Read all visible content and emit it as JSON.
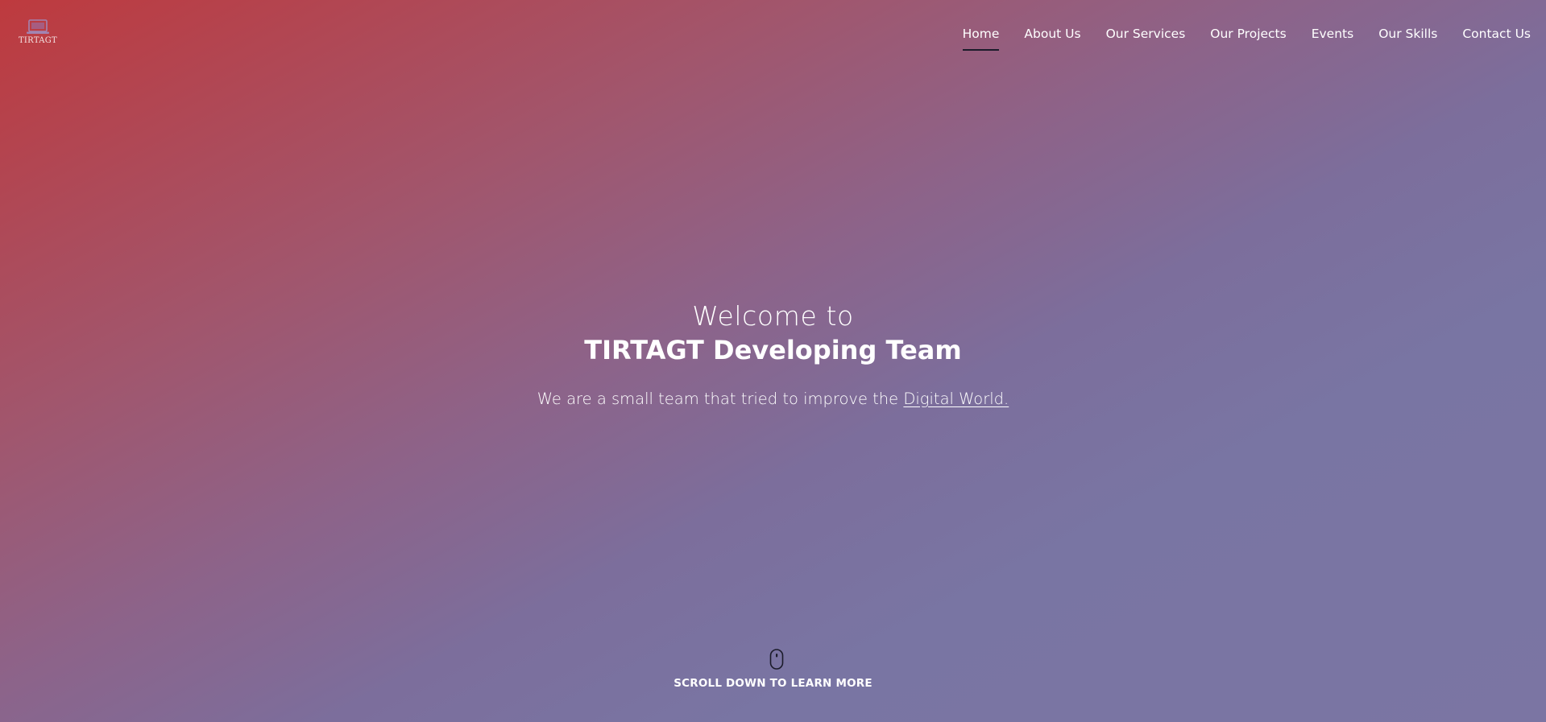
{
  "brand": {
    "logo_text": "TIRTAGT",
    "logo_icon": "laptop-logo-icon"
  },
  "nav": {
    "items": [
      {
        "label": "Home",
        "active": true
      },
      {
        "label": "About Us",
        "active": false
      },
      {
        "label": "Our Services",
        "active": false
      },
      {
        "label": "Our Projects",
        "active": false
      },
      {
        "label": "Events",
        "active": false
      },
      {
        "label": "Our Skills",
        "active": false
      },
      {
        "label": "Contact Us",
        "active": false
      }
    ]
  },
  "hero": {
    "welcome": "Welcome to",
    "title": "TIRTAGT Developing Team",
    "tagline_prefix": "We are a small team that tried to improve the ",
    "tagline_link": "Digital World."
  },
  "scroll": {
    "icon": "mouse-icon",
    "label": "SCROLL DOWN TO LEARN MORE"
  },
  "colors": {
    "gradient_start": "#be3a3e",
    "gradient_mid": "#8d6389",
    "gradient_end": "#7b75a3",
    "text": "#ffffff",
    "active_underline": "#1b1b2a"
  }
}
